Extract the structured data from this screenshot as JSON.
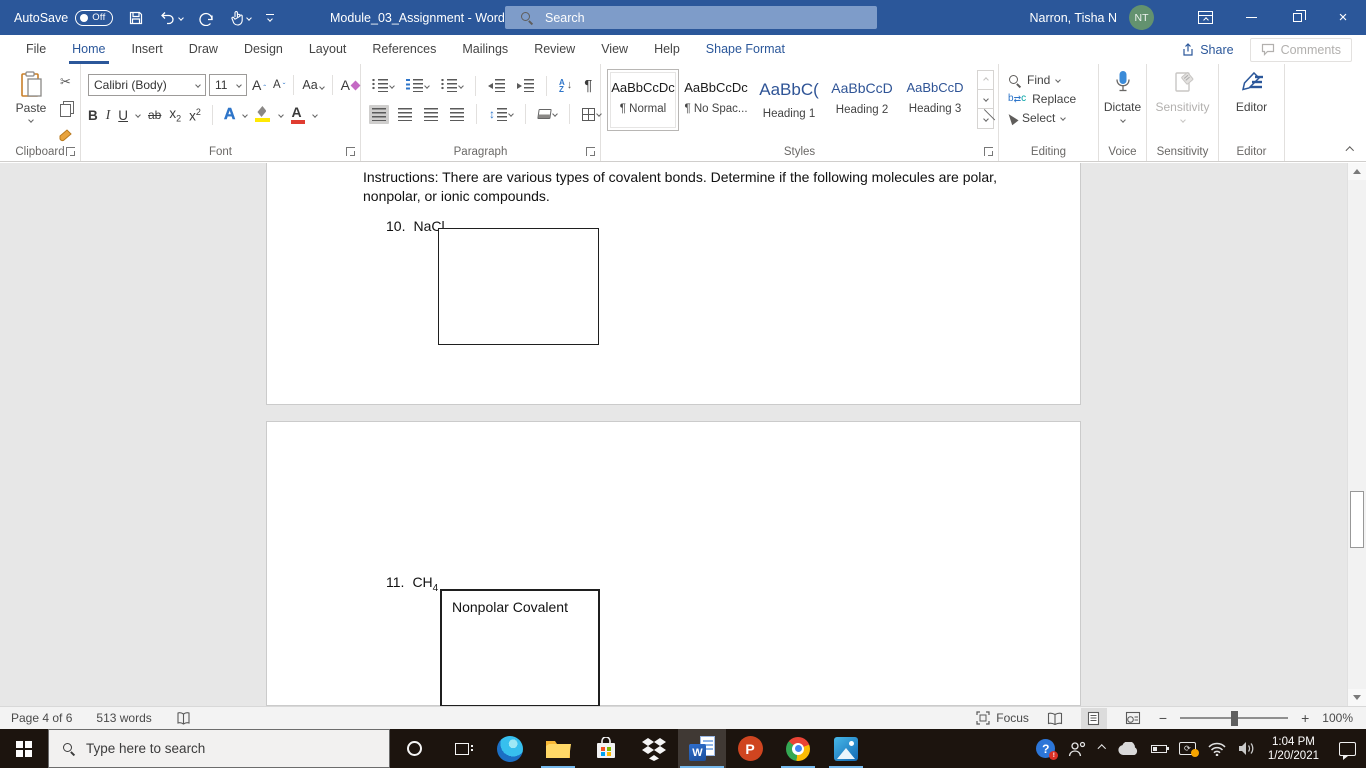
{
  "titlebar": {
    "autosave_label": "AutoSave",
    "autosave_state": "Off",
    "title": "Module_03_Assignment  -  Word",
    "search_placeholder": "Search",
    "user_name": "Narron, Tisha N",
    "user_initials": "NT"
  },
  "tabs": {
    "items": [
      "File",
      "Home",
      "Insert",
      "Draw",
      "Design",
      "Layout",
      "References",
      "Mailings",
      "Review",
      "View",
      "Help",
      "Shape Format"
    ],
    "active_tab": "Home",
    "share_label": "Share",
    "comments_label": "Comments"
  },
  "ribbon": {
    "clipboard": {
      "paste_label": "Paste",
      "group_label": "Clipboard"
    },
    "font": {
      "font_name": "Calibri (Body)",
      "font_size": "11",
      "group_label": "Font"
    },
    "paragraph": {
      "group_label": "Paragraph"
    },
    "styles": {
      "group_label": "Styles",
      "items": [
        {
          "sample": "AaBbCcDc",
          "name": "¶ Normal"
        },
        {
          "sample": "AaBbCcDc",
          "name": "¶ No Spac..."
        },
        {
          "sample": "AaBbC(",
          "name": "Heading 1"
        },
        {
          "sample": "AaBbCcD",
          "name": "Heading 2"
        },
        {
          "sample": "AaBbCcD",
          "name": "Heading 3"
        }
      ]
    },
    "editing": {
      "find_label": "Find",
      "replace_label": "Replace",
      "select_label": "Select",
      "group_label": "Editing"
    },
    "voice": {
      "dictate_label": "Dictate",
      "group_label": "Voice"
    },
    "sensitivity": {
      "button_label": "Sensitivity",
      "group_label": "Sensitivity"
    },
    "editor": {
      "button_label": "Editor",
      "group_label": "Editor"
    }
  },
  "document": {
    "instructions_line1": "Instructions: There are various types of covalent bonds. Determine if the following molecules are polar,",
    "instructions_line2": "nonpolar, or ionic compounds.",
    "q10_number": "10.",
    "q10_formula": "NaCl",
    "q10_answer": "",
    "q11_number": "11.",
    "q11_formula": "CH",
    "q11_formula_subscript": "4",
    "q11_answer": "Nonpolar Covalent"
  },
  "statusbar": {
    "page_indicator": "Page 4 of 6",
    "word_count": "513 words",
    "focus_label": "Focus",
    "zoom_level": "100%"
  },
  "taskbar": {
    "search_placeholder": "Type here to search",
    "time": "1:04 PM",
    "date": "1/20/2021"
  }
}
